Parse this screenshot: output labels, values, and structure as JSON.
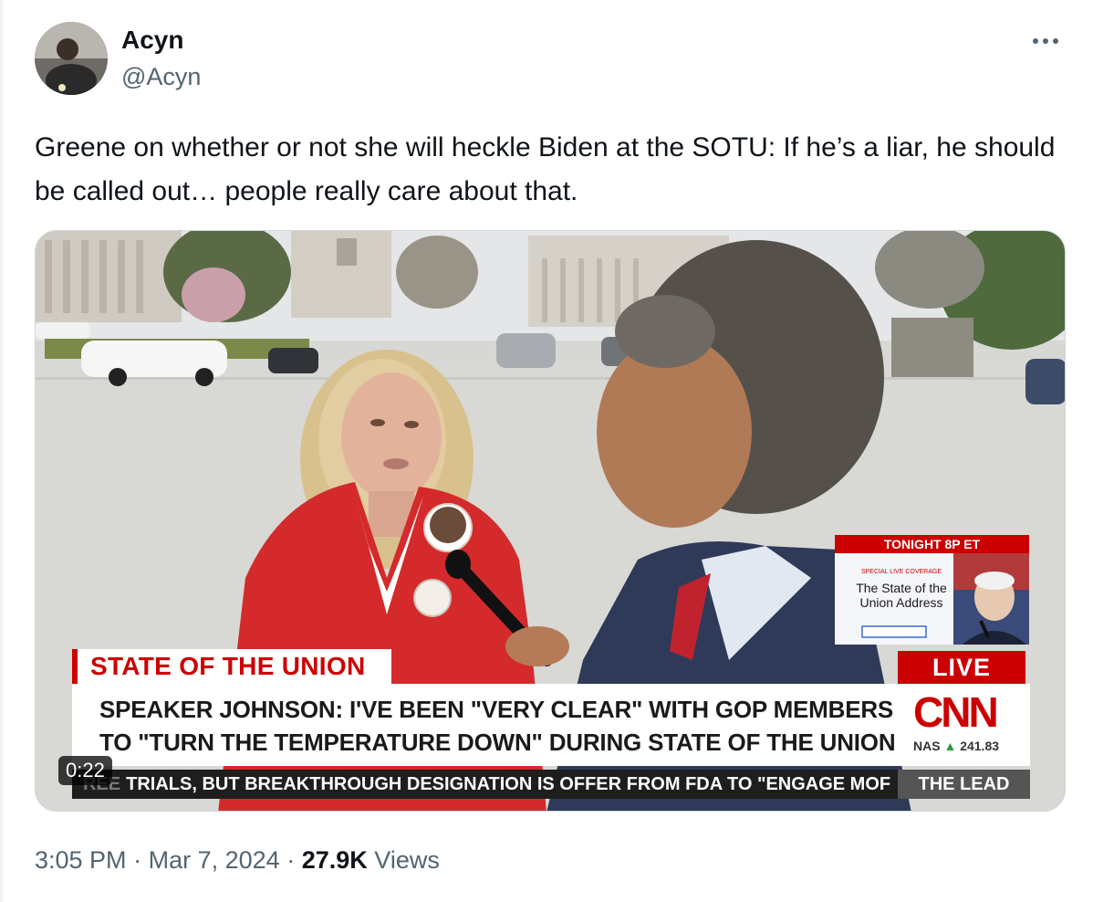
{
  "author": {
    "name": "Acyn",
    "handle": "@Acyn",
    "avatar_icon": "user-avatar"
  },
  "more_icon": "more-horizontal-icon",
  "tweet": {
    "text": "Greene on whether or not she will heckle Biden at the SOTU: If he’s a liar, he should be called out… people really care about that."
  },
  "video": {
    "timer": "0:22",
    "overlay": {
      "section_title": "STATE OF THE UNION",
      "live_label": "LIVE",
      "headline_line1": "SPEAKER JOHNSON: I'VE BEEN \"VERY CLEAR\" WITH GOP MEMBERS",
      "headline_line2": "TO \"TURN THE TEMPERATURE DOWN\" DURING STATE OF THE UNION",
      "ticker": "TRIALS, BUT BREAKTHROUGH DESIGNATION IS OFFER FROM FDA TO \"ENGAGE MOF",
      "ticker_prefix": "REE",
      "show_name": "THE LEAD",
      "network": "CNN",
      "market_label": "NAS",
      "market_value": "241.83",
      "promo_header": "TONIGHT 8P ET",
      "promo_sub": "SPECIAL LIVE COVERAGE",
      "promo_title": "The State of the Union Address"
    }
  },
  "meta": {
    "time": "3:05 PM",
    "separator": "·",
    "date": "Mar 7, 2024",
    "views_count": "27.9K",
    "views_label": "Views"
  },
  "colors": {
    "text_primary": "#0f1419",
    "text_secondary": "#536471",
    "cnn_red": "#cc0000",
    "border": "#cfd9de"
  }
}
